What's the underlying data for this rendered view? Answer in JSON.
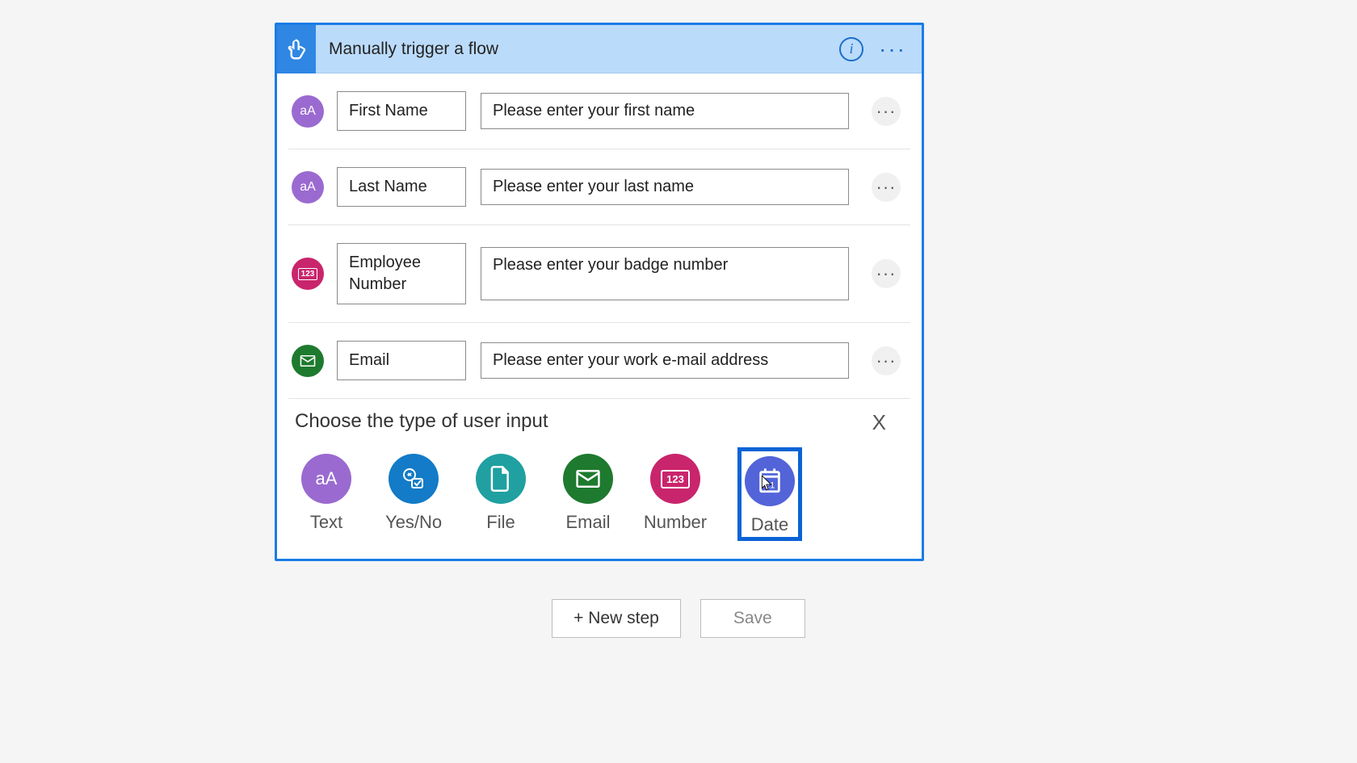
{
  "header": {
    "title": "Manually trigger a flow"
  },
  "inputs": [
    {
      "type": "text",
      "name": "First Name",
      "desc": "Please enter your first name"
    },
    {
      "type": "text",
      "name": "Last Name",
      "desc": "Please enter your last name"
    },
    {
      "type": "number",
      "name": "Employee Number",
      "desc": "Please enter your badge number"
    },
    {
      "type": "email",
      "name": "Email",
      "desc": "Please enter your work e-mail address"
    }
  ],
  "picker": {
    "title": "Choose the type of user input",
    "close": "X",
    "options": [
      {
        "key": "text",
        "label": "Text"
      },
      {
        "key": "yesno",
        "label": "Yes/No"
      },
      {
        "key": "file",
        "label": "File"
      },
      {
        "key": "email",
        "label": "Email"
      },
      {
        "key": "number",
        "label": "Number"
      },
      {
        "key": "date",
        "label": "Date",
        "selected": true
      }
    ]
  },
  "footer": {
    "newStep": "+ New step",
    "save": "Save"
  }
}
